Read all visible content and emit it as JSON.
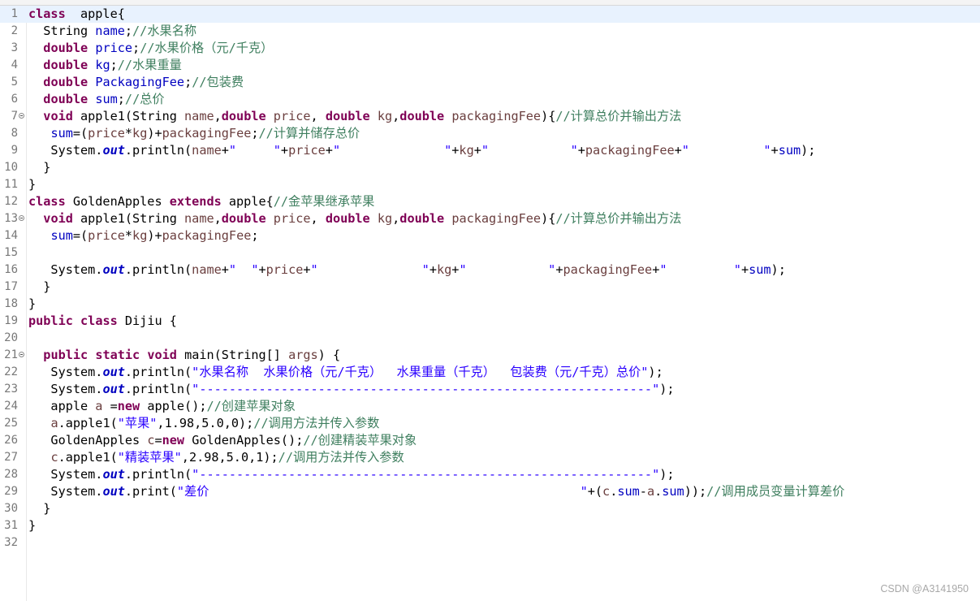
{
  "editor": {
    "language": "java",
    "current_line": 1,
    "lines": [
      {
        "n": "1",
        "fold": false,
        "tokens": [
          [
            "k",
            "class"
          ],
          [
            "",
            "  apple{"
          ]
        ]
      },
      {
        "n": "2",
        "fold": false,
        "tokens": [
          [
            "",
            "  String "
          ],
          [
            "f",
            "name"
          ],
          [
            "",
            ";"
          ],
          [
            "c",
            "//水果名称"
          ]
        ]
      },
      {
        "n": "3",
        "fold": false,
        "tokens": [
          [
            "",
            "  "
          ],
          [
            "k",
            "double"
          ],
          [
            "",
            " "
          ],
          [
            "f",
            "price"
          ],
          [
            "",
            ";"
          ],
          [
            "c",
            "//水果价格（元/千克）"
          ]
        ]
      },
      {
        "n": "4",
        "fold": false,
        "tokens": [
          [
            "",
            "  "
          ],
          [
            "k",
            "double"
          ],
          [
            "",
            " "
          ],
          [
            "f",
            "kg"
          ],
          [
            "",
            ";"
          ],
          [
            "c",
            "//水果重量"
          ]
        ]
      },
      {
        "n": "5",
        "fold": false,
        "tokens": [
          [
            "",
            "  "
          ],
          [
            "k",
            "double"
          ],
          [
            "",
            " "
          ],
          [
            "f",
            "PackagingFee"
          ],
          [
            "",
            ";"
          ],
          [
            "c",
            "//包装费"
          ]
        ]
      },
      {
        "n": "6",
        "fold": false,
        "tokens": [
          [
            "",
            "  "
          ],
          [
            "k",
            "double"
          ],
          [
            "",
            " "
          ],
          [
            "f",
            "sum"
          ],
          [
            "",
            ";"
          ],
          [
            "c",
            "//总价"
          ]
        ]
      },
      {
        "n": "7",
        "fold": true,
        "tokens": [
          [
            "",
            "  "
          ],
          [
            "k",
            "void"
          ],
          [
            "",
            " apple1(String "
          ],
          [
            "p",
            "name"
          ],
          [
            "",
            ","
          ],
          [
            "k",
            "double"
          ],
          [
            "",
            " "
          ],
          [
            "p",
            "price"
          ],
          [
            "",
            ", "
          ],
          [
            "k",
            "double"
          ],
          [
            "",
            " "
          ],
          [
            "p",
            "kg"
          ],
          [
            "",
            ","
          ],
          [
            "k",
            "double"
          ],
          [
            "",
            " "
          ],
          [
            "p",
            "packagingFee"
          ],
          [
            "",
            "){"
          ],
          [
            "c",
            "//计算总价并输出方法"
          ]
        ]
      },
      {
        "n": "8",
        "fold": false,
        "tokens": [
          [
            "",
            "   "
          ],
          [
            "f",
            "sum"
          ],
          [
            "",
            "=("
          ],
          [
            "p",
            "price"
          ],
          [
            "",
            "*"
          ],
          [
            "p",
            "kg"
          ],
          [
            "",
            ")+"
          ],
          [
            "p",
            "packagingFee"
          ],
          [
            "",
            ";"
          ],
          [
            "c",
            "//计算并储存总价"
          ]
        ]
      },
      {
        "n": "9",
        "fold": false,
        "tokens": [
          [
            "",
            "   System."
          ],
          [
            "fi",
            "out"
          ],
          [
            "",
            ".println("
          ],
          [
            "p",
            "name"
          ],
          [
            "",
            "+"
          ],
          [
            "s",
            "\"     \""
          ],
          [
            "",
            "+"
          ],
          [
            "p",
            "price"
          ],
          [
            "",
            "+"
          ],
          [
            "s",
            "\"              \""
          ],
          [
            "",
            "+"
          ],
          [
            "p",
            "kg"
          ],
          [
            "",
            "+"
          ],
          [
            "s",
            "\"           \""
          ],
          [
            "",
            "+"
          ],
          [
            "p",
            "packagingFee"
          ],
          [
            "",
            "+"
          ],
          [
            "s",
            "\"          \""
          ],
          [
            "",
            "+"
          ],
          [
            "f",
            "sum"
          ],
          [
            "",
            ");"
          ]
        ]
      },
      {
        "n": "10",
        "fold": false,
        "tokens": [
          [
            "",
            "  }"
          ]
        ]
      },
      {
        "n": "11",
        "fold": false,
        "tokens": [
          [
            "",
            "}"
          ]
        ]
      },
      {
        "n": "12",
        "fold": false,
        "tokens": [
          [
            "k",
            "class"
          ],
          [
            "",
            " GoldenApples "
          ],
          [
            "k",
            "extends"
          ],
          [
            "",
            " apple{"
          ],
          [
            "c",
            "//金苹果继承苹果"
          ]
        ]
      },
      {
        "n": "13",
        "fold": true,
        "tokens": [
          [
            "",
            "  "
          ],
          [
            "k",
            "void"
          ],
          [
            "",
            " apple1(String "
          ],
          [
            "p",
            "name"
          ],
          [
            "",
            ","
          ],
          [
            "k",
            "double"
          ],
          [
            "",
            " "
          ],
          [
            "p",
            "price"
          ],
          [
            "",
            ", "
          ],
          [
            "k",
            "double"
          ],
          [
            "",
            " "
          ],
          [
            "p",
            "kg"
          ],
          [
            "",
            ","
          ],
          [
            "k",
            "double"
          ],
          [
            "",
            " "
          ],
          [
            "p",
            "packagingFee"
          ],
          [
            "",
            "){"
          ],
          [
            "c",
            "//计算总价并输出方法"
          ]
        ]
      },
      {
        "n": "14",
        "fold": false,
        "tokens": [
          [
            "",
            "   "
          ],
          [
            "f",
            "sum"
          ],
          [
            "",
            "=("
          ],
          [
            "p",
            "price"
          ],
          [
            "",
            "*"
          ],
          [
            "p",
            "kg"
          ],
          [
            "",
            ")+"
          ],
          [
            "p",
            "packagingFee"
          ],
          [
            "",
            ";"
          ]
        ]
      },
      {
        "n": "15",
        "fold": false,
        "tokens": []
      },
      {
        "n": "16",
        "fold": false,
        "tokens": [
          [
            "",
            "   System."
          ],
          [
            "fi",
            "out"
          ],
          [
            "",
            ".println("
          ],
          [
            "p",
            "name"
          ],
          [
            "",
            "+"
          ],
          [
            "s",
            "\"  \""
          ],
          [
            "",
            "+"
          ],
          [
            "p",
            "price"
          ],
          [
            "",
            "+"
          ],
          [
            "s",
            "\"              \""
          ],
          [
            "",
            "+"
          ],
          [
            "p",
            "kg"
          ],
          [
            "",
            "+"
          ],
          [
            "s",
            "\"           \""
          ],
          [
            "",
            "+"
          ],
          [
            "p",
            "packagingFee"
          ],
          [
            "",
            "+"
          ],
          [
            "s",
            "\"         \""
          ],
          [
            "",
            "+"
          ],
          [
            "f",
            "sum"
          ],
          [
            "",
            ");"
          ]
        ]
      },
      {
        "n": "17",
        "fold": false,
        "tokens": [
          [
            "",
            "  }"
          ]
        ]
      },
      {
        "n": "18",
        "fold": false,
        "tokens": [
          [
            "",
            "}"
          ]
        ]
      },
      {
        "n": "19",
        "fold": false,
        "tokens": [
          [
            "k",
            "public"
          ],
          [
            "",
            " "
          ],
          [
            "k",
            "class"
          ],
          [
            "",
            " Dijiu {"
          ]
        ]
      },
      {
        "n": "20",
        "fold": false,
        "tokens": []
      },
      {
        "n": "21",
        "fold": true,
        "tokens": [
          [
            "",
            "  "
          ],
          [
            "k",
            "public"
          ],
          [
            "",
            " "
          ],
          [
            "k",
            "static"
          ],
          [
            "",
            " "
          ],
          [
            "k",
            "void"
          ],
          [
            "",
            " main(String[] "
          ],
          [
            "p",
            "args"
          ],
          [
            "",
            ") {"
          ]
        ]
      },
      {
        "n": "22",
        "fold": false,
        "tokens": [
          [
            "",
            "   System."
          ],
          [
            "fi",
            "out"
          ],
          [
            "",
            ".println("
          ],
          [
            "s",
            "\"水果名称  水果价格（元/千克）  水果重量（千克）  包装费（元/千克）总价\""
          ],
          [
            "",
            ");"
          ]
        ]
      },
      {
        "n": "23",
        "fold": false,
        "tokens": [
          [
            "",
            "   System."
          ],
          [
            "fi",
            "out"
          ],
          [
            "",
            ".println("
          ],
          [
            "s",
            "\"-------------------------------------------------------------\""
          ],
          [
            "",
            ");"
          ]
        ]
      },
      {
        "n": "24",
        "fold": false,
        "tokens": [
          [
            "",
            "   apple "
          ],
          [
            "p",
            "a"
          ],
          [
            "",
            " ="
          ],
          [
            "k",
            "new"
          ],
          [
            "",
            " apple();"
          ],
          [
            "c",
            "//创建苹果对象"
          ]
        ]
      },
      {
        "n": "25",
        "fold": false,
        "tokens": [
          [
            "",
            "   "
          ],
          [
            "p",
            "a"
          ],
          [
            "",
            ".apple1("
          ],
          [
            "s",
            "\"苹果\""
          ],
          [
            "",
            ",1.98,5.0,0);"
          ],
          [
            "c",
            "//调用方法并传入参数"
          ]
        ]
      },
      {
        "n": "26",
        "fold": false,
        "tokens": [
          [
            "",
            "   GoldenApples "
          ],
          [
            "p",
            "c"
          ],
          [
            "",
            "="
          ],
          [
            "k",
            "new"
          ],
          [
            "",
            " GoldenApples();"
          ],
          [
            "c",
            "//创建精装苹果对象"
          ]
        ]
      },
      {
        "n": "27",
        "fold": false,
        "tokens": [
          [
            "",
            "   "
          ],
          [
            "p",
            "c"
          ],
          [
            "",
            ".apple1("
          ],
          [
            "s",
            "\"精装苹果\""
          ],
          [
            "",
            ",2.98,5.0,1);"
          ],
          [
            "c",
            "//调用方法并传入参数"
          ]
        ]
      },
      {
        "n": "28",
        "fold": false,
        "tokens": [
          [
            "",
            "   System."
          ],
          [
            "fi",
            "out"
          ],
          [
            "",
            ".println("
          ],
          [
            "s",
            "\"-------------------------------------------------------------\""
          ],
          [
            "",
            ");"
          ]
        ]
      },
      {
        "n": "29",
        "fold": false,
        "tokens": [
          [
            "",
            "   System."
          ],
          [
            "fi",
            "out"
          ],
          [
            "",
            ".print("
          ],
          [
            "s",
            "\"差价                                                  \""
          ],
          [
            "",
            "+("
          ],
          [
            "p",
            "c"
          ],
          [
            "",
            "."
          ],
          [
            "f",
            "sum"
          ],
          [
            "",
            "-"
          ],
          [
            "p",
            "a"
          ],
          [
            "",
            "."
          ],
          [
            "f",
            "sum"
          ],
          [
            "",
            "));"
          ],
          [
            "c",
            "//调用成员变量计算差价"
          ]
        ]
      },
      {
        "n": "30",
        "fold": false,
        "tokens": [
          [
            "",
            "  }"
          ]
        ]
      },
      {
        "n": "31",
        "fold": false,
        "tokens": [
          [
            "",
            "}"
          ]
        ]
      },
      {
        "n": "32",
        "fold": false,
        "tokens": []
      }
    ]
  },
  "colors": {
    "keyword": "#7f0055",
    "field": "#0000c0",
    "string": "#2a00ff",
    "comment": "#3f7f5f",
    "local": "#6a3e3e",
    "current_line_bg": "#e8f2fe"
  },
  "watermark": "CSDN @A3141950"
}
